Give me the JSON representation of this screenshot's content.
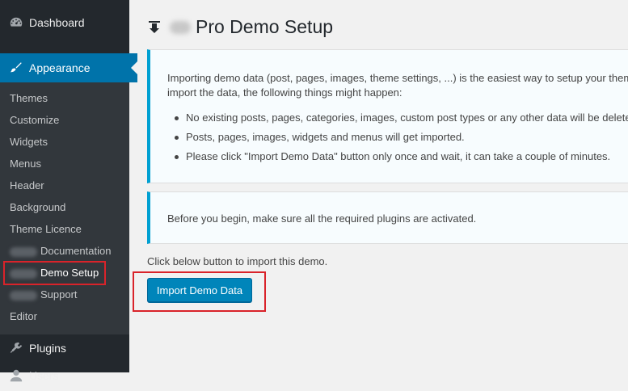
{
  "sidebar": {
    "dashboard": {
      "label": "Dashboard",
      "icon": "dashboard-icon"
    },
    "appearance": {
      "label": "Appearance",
      "icon": "paintbrush-icon"
    },
    "submenu": [
      {
        "label": "Themes"
      },
      {
        "label": "Customize"
      },
      {
        "label": "Widgets"
      },
      {
        "label": "Menus"
      },
      {
        "label": "Header"
      },
      {
        "label": "Background"
      },
      {
        "label": "Theme Licence"
      },
      {
        "label": "Documentation"
      },
      {
        "label": "Demo Setup"
      },
      {
        "label": "Support"
      },
      {
        "label": "Editor"
      }
    ],
    "plugins": {
      "label": "Plugins",
      "icon": "plugin-icon"
    },
    "users": {
      "label": "Users",
      "icon": "users-icon"
    }
  },
  "main": {
    "title": "Pro Demo Setup",
    "notice1": {
      "line1": "Importing demo data (post, pages, images, theme settings, ...) is the easiest way to setup your theme.",
      "line2": "import the data, the following things might happen:",
      "items": [
        "No existing posts, pages, categories, images, custom post types or any other data will be deleted",
        "Posts, pages, images, widgets and menus will get imported.",
        "Please click \"Import Demo Data\" button only once and wait, it can take a couple of minutes."
      ]
    },
    "notice2": {
      "text": "Before you begin, make sure all the required plugins are activated."
    },
    "below_text": "Click below button to import this demo.",
    "import_button": "Import Demo Data"
  },
  "colors": {
    "sidebar_bg": "#23282d",
    "submenu_bg": "#32373c",
    "active_menu": "#0073aa",
    "button": "#0085ba",
    "highlight": "#d9232a",
    "notice_border": "#00a0d2"
  }
}
